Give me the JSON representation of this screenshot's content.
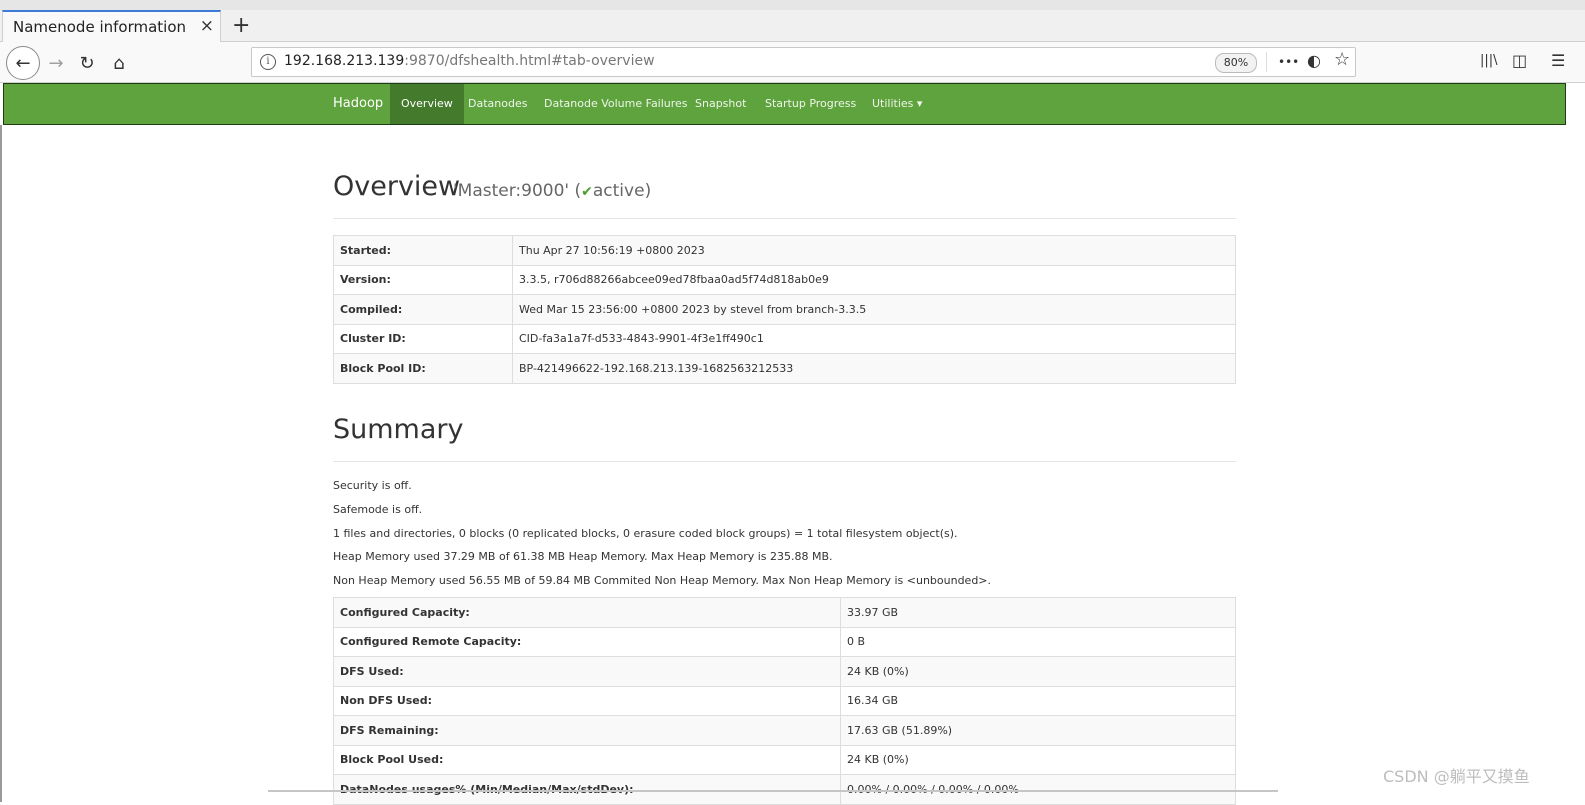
{
  "browser": {
    "tab_title": "Namenode information",
    "tab_close": "×",
    "new_tab": "+",
    "url_host": "192.168.213.139",
    "url_rest": ":9870/dfshealth.html#tab-overview",
    "zoom": "80%",
    "icons": {
      "back": "←",
      "forward": "→",
      "reload": "↻",
      "home": "⌂",
      "more": "•••",
      "pocket": "◐",
      "bookmark": "☆",
      "library": "|||\\",
      "sidebar": "◫",
      "menu": "☰"
    }
  },
  "hadoop_nav": {
    "brand": "Hadoop",
    "items": [
      "Overview",
      "Datanodes",
      "Datanode Volume Failures",
      "Snapshot",
      "Startup Progress",
      "Utilities ▾"
    ]
  },
  "overview": {
    "title": "Overview",
    "sub_prefix": "'Master:9000' (",
    "check": "✔",
    "status": "active",
    "sub_suffix": ")",
    "rows": [
      {
        "k": "Started:",
        "v": "Thu Apr 27 10:56:19 +0800 2023"
      },
      {
        "k": "Version:",
        "v": "3.3.5, r706d88266abcee09ed78fbaa0ad5f74d818ab0e9"
      },
      {
        "k": "Compiled:",
        "v": "Wed Mar 15 23:56:00 +0800 2023 by stevel from branch-3.3.5"
      },
      {
        "k": "Cluster ID:",
        "v": "CID-fa3a1a7f-d533-4843-9901-4f3e1ff490c1"
      },
      {
        "k": "Block Pool ID:",
        "v": "BP-421496622-192.168.213.139-1682563212533"
      }
    ]
  },
  "summary": {
    "title": "Summary",
    "lines": [
      "Security is off.",
      "Safemode is off.",
      "1 files and directories, 0 blocks (0 replicated blocks, 0 erasure coded block groups) = 1 total filesystem object(s).",
      "Heap Memory used 37.29 MB of 61.38 MB Heap Memory. Max Heap Memory is 235.88 MB.",
      "Non Heap Memory used 56.55 MB of 59.84 MB Commited Non Heap Memory. Max Non Heap Memory is <unbounded>."
    ],
    "rows": [
      {
        "k": "Configured Capacity:",
        "v": "33.97 GB"
      },
      {
        "k": "Configured Remote Capacity:",
        "v": "0 B"
      },
      {
        "k": "DFS Used:",
        "v": "24 KB (0%)"
      },
      {
        "k": "Non DFS Used:",
        "v": "16.34 GB"
      },
      {
        "k": "DFS Remaining:",
        "v": "17.63 GB (51.89%)"
      },
      {
        "k": "Block Pool Used:",
        "v": "24 KB (0%)"
      },
      {
        "k": "DataNodes usages% (Min/Median/Max/stdDev):",
        "v": "0.00% / 0.00% / 0.00% / 0.00%"
      }
    ]
  },
  "watermark": "CSDN @躺平又摸鱼"
}
